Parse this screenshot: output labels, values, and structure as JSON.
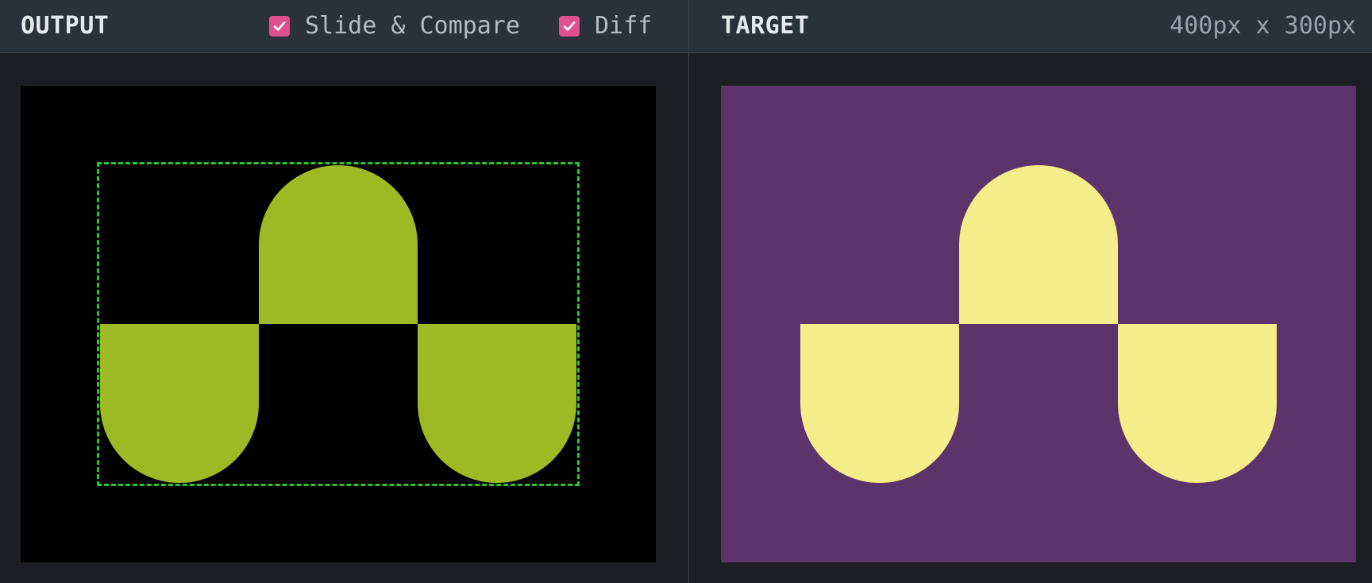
{
  "output": {
    "title": "OUTPUT",
    "slide_compare": {
      "label": "Slide & Compare",
      "checked": true
    },
    "diff": {
      "label": "Diff",
      "checked": true
    },
    "canvas_background": "#000000",
    "shape_color": "#9db923",
    "diff_outline_color": "#22cc22"
  },
  "target": {
    "title": "TARGET",
    "dimensions": "400px x 300px",
    "canvas_background": "#5c346b",
    "shape_color": "#f5ec8a"
  },
  "accent_color": "#e0508f",
  "icons": {
    "checkbox": "checkmark-icon"
  }
}
